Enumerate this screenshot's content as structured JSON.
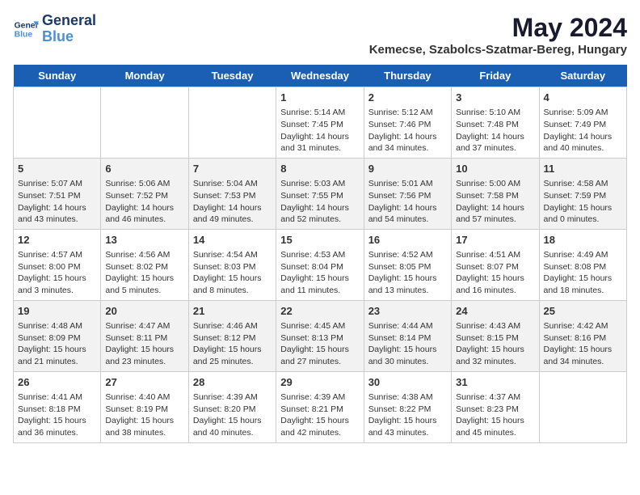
{
  "header": {
    "logo_line1": "General",
    "logo_line2": "Blue",
    "title": "May 2024",
    "subtitle": "Kemecse, Szabolcs-Szatmar-Bereg, Hungary"
  },
  "weekdays": [
    "Sunday",
    "Monday",
    "Tuesday",
    "Wednesday",
    "Thursday",
    "Friday",
    "Saturday"
  ],
  "weeks": [
    [
      {
        "date": "",
        "content": ""
      },
      {
        "date": "",
        "content": ""
      },
      {
        "date": "",
        "content": ""
      },
      {
        "date": "1",
        "content": "Sunrise: 5:14 AM\nSunset: 7:45 PM\nDaylight: 14 hours\nand 31 minutes."
      },
      {
        "date": "2",
        "content": "Sunrise: 5:12 AM\nSunset: 7:46 PM\nDaylight: 14 hours\nand 34 minutes."
      },
      {
        "date": "3",
        "content": "Sunrise: 5:10 AM\nSunset: 7:48 PM\nDaylight: 14 hours\nand 37 minutes."
      },
      {
        "date": "4",
        "content": "Sunrise: 5:09 AM\nSunset: 7:49 PM\nDaylight: 14 hours\nand 40 minutes."
      }
    ],
    [
      {
        "date": "5",
        "content": "Sunrise: 5:07 AM\nSunset: 7:51 PM\nDaylight: 14 hours\nand 43 minutes."
      },
      {
        "date": "6",
        "content": "Sunrise: 5:06 AM\nSunset: 7:52 PM\nDaylight: 14 hours\nand 46 minutes."
      },
      {
        "date": "7",
        "content": "Sunrise: 5:04 AM\nSunset: 7:53 PM\nDaylight: 14 hours\nand 49 minutes."
      },
      {
        "date": "8",
        "content": "Sunrise: 5:03 AM\nSunset: 7:55 PM\nDaylight: 14 hours\nand 52 minutes."
      },
      {
        "date": "9",
        "content": "Sunrise: 5:01 AM\nSunset: 7:56 PM\nDaylight: 14 hours\nand 54 minutes."
      },
      {
        "date": "10",
        "content": "Sunrise: 5:00 AM\nSunset: 7:58 PM\nDaylight: 14 hours\nand 57 minutes."
      },
      {
        "date": "11",
        "content": "Sunrise: 4:58 AM\nSunset: 7:59 PM\nDaylight: 15 hours\nand 0 minutes."
      }
    ],
    [
      {
        "date": "12",
        "content": "Sunrise: 4:57 AM\nSunset: 8:00 PM\nDaylight: 15 hours\nand 3 minutes."
      },
      {
        "date": "13",
        "content": "Sunrise: 4:56 AM\nSunset: 8:02 PM\nDaylight: 15 hours\nand 5 minutes."
      },
      {
        "date": "14",
        "content": "Sunrise: 4:54 AM\nSunset: 8:03 PM\nDaylight: 15 hours\nand 8 minutes."
      },
      {
        "date": "15",
        "content": "Sunrise: 4:53 AM\nSunset: 8:04 PM\nDaylight: 15 hours\nand 11 minutes."
      },
      {
        "date": "16",
        "content": "Sunrise: 4:52 AM\nSunset: 8:05 PM\nDaylight: 15 hours\nand 13 minutes."
      },
      {
        "date": "17",
        "content": "Sunrise: 4:51 AM\nSunset: 8:07 PM\nDaylight: 15 hours\nand 16 minutes."
      },
      {
        "date": "18",
        "content": "Sunrise: 4:49 AM\nSunset: 8:08 PM\nDaylight: 15 hours\nand 18 minutes."
      }
    ],
    [
      {
        "date": "19",
        "content": "Sunrise: 4:48 AM\nSunset: 8:09 PM\nDaylight: 15 hours\nand 21 minutes."
      },
      {
        "date": "20",
        "content": "Sunrise: 4:47 AM\nSunset: 8:11 PM\nDaylight: 15 hours\nand 23 minutes."
      },
      {
        "date": "21",
        "content": "Sunrise: 4:46 AM\nSunset: 8:12 PM\nDaylight: 15 hours\nand 25 minutes."
      },
      {
        "date": "22",
        "content": "Sunrise: 4:45 AM\nSunset: 8:13 PM\nDaylight: 15 hours\nand 27 minutes."
      },
      {
        "date": "23",
        "content": "Sunrise: 4:44 AM\nSunset: 8:14 PM\nDaylight: 15 hours\nand 30 minutes."
      },
      {
        "date": "24",
        "content": "Sunrise: 4:43 AM\nSunset: 8:15 PM\nDaylight: 15 hours\nand 32 minutes."
      },
      {
        "date": "25",
        "content": "Sunrise: 4:42 AM\nSunset: 8:16 PM\nDaylight: 15 hours\nand 34 minutes."
      }
    ],
    [
      {
        "date": "26",
        "content": "Sunrise: 4:41 AM\nSunset: 8:18 PM\nDaylight: 15 hours\nand 36 minutes."
      },
      {
        "date": "27",
        "content": "Sunrise: 4:40 AM\nSunset: 8:19 PM\nDaylight: 15 hours\nand 38 minutes."
      },
      {
        "date": "28",
        "content": "Sunrise: 4:39 AM\nSunset: 8:20 PM\nDaylight: 15 hours\nand 40 minutes."
      },
      {
        "date": "29",
        "content": "Sunrise: 4:39 AM\nSunset: 8:21 PM\nDaylight: 15 hours\nand 42 minutes."
      },
      {
        "date": "30",
        "content": "Sunrise: 4:38 AM\nSunset: 8:22 PM\nDaylight: 15 hours\nand 43 minutes."
      },
      {
        "date": "31",
        "content": "Sunrise: 4:37 AM\nSunset: 8:23 PM\nDaylight: 15 hours\nand 45 minutes."
      },
      {
        "date": "",
        "content": ""
      }
    ]
  ]
}
